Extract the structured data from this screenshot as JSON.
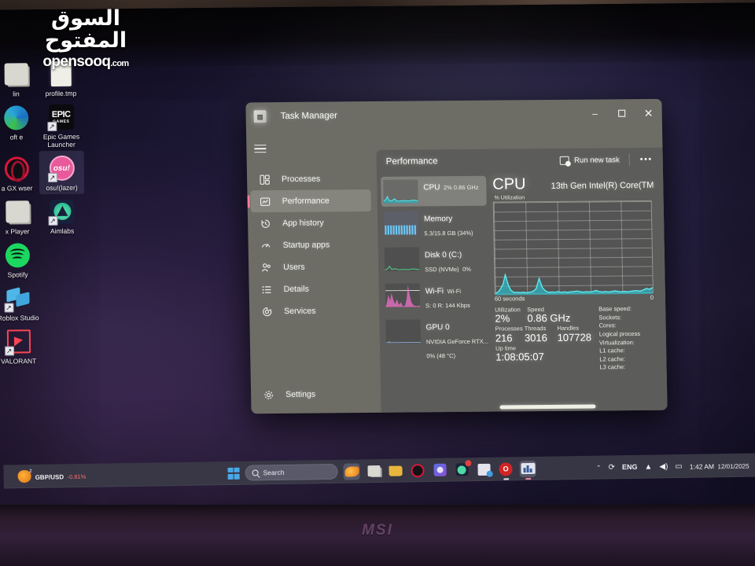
{
  "watermark": {
    "arabic": "السوق المفتوح",
    "latin": "opensooq",
    "domain": ".com"
  },
  "desktop": {
    "icons": [
      {
        "label": "lin",
        "icon": "generic-icon",
        "selected": false
      },
      {
        "label": "profile.tmp",
        "icon": "file-icon",
        "selected": false
      },
      {
        "label": "oft\ne",
        "icon": "edge-icon",
        "selected": false
      },
      {
        "label": "Epic Games Launcher",
        "icon": "epic-games-icon",
        "selected": false
      },
      {
        "label": "a GX\nwser",
        "icon": "opera-gx-icon",
        "selected": false
      },
      {
        "label": "osu!(lazer)",
        "icon": "osu-icon",
        "selected": true
      },
      {
        "label": "x Player",
        "icon": "roblox-player-icon",
        "selected": false
      },
      {
        "label": "Aimlabs",
        "icon": "aimlabs-icon",
        "selected": false
      },
      {
        "label": "Spotify",
        "icon": "spotify-icon",
        "selected": false
      },
      {
        "label": "Roblox Studio",
        "icon": "roblox-studio-icon",
        "selected": false
      },
      {
        "label": "VALORANT",
        "icon": "valorant-icon",
        "selected": false
      }
    ]
  },
  "task_manager": {
    "title": "Task Manager",
    "window_controls": {
      "minimize": "–",
      "maximize": "❐",
      "close": "✕"
    },
    "nav": [
      {
        "label": "Processes",
        "icon": "processes-icon",
        "active": false
      },
      {
        "label": "Performance",
        "icon": "performance-icon",
        "active": true
      },
      {
        "label": "App history",
        "icon": "app-history-icon",
        "active": false
      },
      {
        "label": "Startup apps",
        "icon": "startup-apps-icon",
        "active": false
      },
      {
        "label": "Users",
        "icon": "users-icon",
        "active": false
      },
      {
        "label": "Details",
        "icon": "details-icon",
        "active": false
      },
      {
        "label": "Services",
        "icon": "services-icon",
        "active": false
      }
    ],
    "settings_label": "Settings",
    "header": {
      "title": "Performance",
      "run_new_task": "Run new task",
      "more_options": "•••"
    },
    "resources": [
      {
        "name": "CPU",
        "lines": [
          "2%  0.86 GHz"
        ],
        "active": true,
        "spark_color": "#3fe0e8"
      },
      {
        "name": "Memory",
        "lines": [
          "5.3/15.8 GB (34%)"
        ],
        "active": false,
        "spark_color": "#5aa8f0"
      },
      {
        "name": "Disk 0 (C:)",
        "lines": [
          "SSD (NVMe)",
          "0%"
        ],
        "active": false,
        "spark_color": "#4fd08a"
      },
      {
        "name": "Wi-Fi",
        "lines": [
          "Wi-Fi",
          "S: 0 R: 144 Kbps"
        ],
        "active": false,
        "spark_color": "#f070c8"
      },
      {
        "name": "GPU 0",
        "lines": [
          "NVIDIA GeForce RTX...",
          "0%  (48 °C)"
        ],
        "active": false,
        "spark_color": "#7aa0e0"
      }
    ],
    "cpu": {
      "heading": "CPU",
      "model": "13th Gen Intel(R) Core(TM",
      "graph_axis_label": "% Utilization",
      "graph_left_label": "60 seconds",
      "graph_right_label": "0",
      "stats": [
        {
          "key": "Utilization",
          "value": "2%"
        },
        {
          "key": "Speed",
          "value": "0.86 GHz"
        },
        {
          "key": "Processes",
          "value": "216"
        },
        {
          "key": "Threads",
          "value": "3016"
        },
        {
          "key": "Handles",
          "value": "107728"
        },
        {
          "key": "Up time",
          "value": "1:08:05:07"
        }
      ],
      "specs": [
        {
          "key": "Base speed:",
          "value": ""
        },
        {
          "key": "Sockets:",
          "value": ""
        },
        {
          "key": "Cores:",
          "value": ""
        },
        {
          "key": "Logical process",
          "value": ""
        },
        {
          "key": "Virtualization:",
          "value": ""
        },
        {
          "key": "L1 cache:",
          "value": ""
        },
        {
          "key": "L2 cache:",
          "value": ""
        },
        {
          "key": "L3 cache:",
          "value": ""
        }
      ]
    }
  },
  "chart_data": {
    "type": "area",
    "title": "CPU",
    "subtitle": "% Utilization",
    "xlabel": "60 seconds",
    "ylabel": "% Utilization",
    "ylim": [
      0,
      100
    ],
    "xlim": [
      0,
      60
    ],
    "grid": true,
    "legend": "none",
    "series": [
      {
        "name": "CPU Utilization",
        "color": "#3fe0e8",
        "values": [
          2,
          3,
          6,
          14,
          22,
          9,
          5,
          4,
          3,
          3,
          4,
          3,
          3,
          4,
          6,
          12,
          8,
          4,
          3,
          3,
          3,
          4,
          3,
          3,
          4,
          3,
          3,
          4,
          5,
          4,
          3,
          3,
          4,
          3,
          3,
          4,
          6,
          4,
          3,
          3,
          4,
          3,
          4,
          5,
          4,
          3,
          3,
          4,
          3,
          4,
          3,
          3,
          4,
          5,
          4,
          3,
          4,
          6,
          9,
          7
        ]
      }
    ]
  },
  "taskbar": {
    "widget": {
      "title": "GBP/USD",
      "change": "-0.81%"
    },
    "start_label": "Start",
    "search_placeholder": "Search",
    "apps": [
      {
        "name": "fish-widget-icon",
        "active": true,
        "badge": false,
        "running": false
      },
      {
        "name": "snipping-tool-icon",
        "active": false,
        "badge": false,
        "running": false
      },
      {
        "name": "file-explorer-icon",
        "active": false,
        "badge": false,
        "running": false
      },
      {
        "name": "opera-gx-icon",
        "active": false,
        "badge": false,
        "running": false
      },
      {
        "name": "copilot-icon",
        "active": false,
        "badge": false,
        "running": false
      },
      {
        "name": "aimlabs-icon",
        "active": false,
        "badge": true,
        "running": false
      },
      {
        "name": "sticky-notes-icon",
        "active": false,
        "badge": false,
        "running": false
      },
      {
        "name": "opera-icon",
        "active": false,
        "badge": false,
        "running": true
      },
      {
        "name": "task-manager-icon",
        "active": true,
        "badge": false,
        "running": true
      }
    ],
    "tray": {
      "chevron": "⌃",
      "network_status_icon": "sync-icon",
      "language": "ENG",
      "wifi_icon": "wifi-icon",
      "volume_icon": "speaker-icon",
      "battery_icon": "battery-icon",
      "time": "1:42 AM",
      "date": "12/01/2025"
    }
  },
  "laptop": {
    "brand": "MSI"
  }
}
